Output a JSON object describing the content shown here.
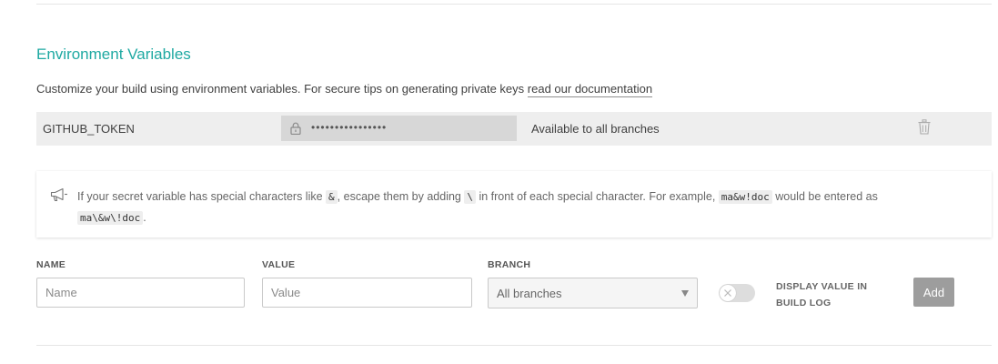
{
  "section": {
    "title": "Environment Variables",
    "intro_text": "Customize your build using environment variables. For secure tips on generating private keys ",
    "intro_link": "read our documentation"
  },
  "variables": [
    {
      "name": "GITHUB_TOKEN",
      "masked_value": "••••••••••••••••",
      "branch": "Available to all branches"
    }
  ],
  "notice": {
    "part1": "If your secret variable has special characters like ",
    "code1": "&",
    "part2": ", escape them by adding ",
    "code2": "\\",
    "part3": " in front of each special character. For example, ",
    "code3": "ma&w!doc",
    "part4": " would be entered as",
    "code4": "ma\\&w\\!doc",
    "part5": "."
  },
  "form": {
    "name_label": "NAME",
    "name_placeholder": "Name",
    "value_label": "VALUE",
    "value_placeholder": "Value",
    "branch_label": "BRANCH",
    "branch_selected": "All branches",
    "display_label": "DISPLAY VALUE IN BUILD LOG",
    "display_enabled": false,
    "add_label": "Add"
  },
  "colors": {
    "accent": "#1fa9a2",
    "row_bg": "#eeeeee",
    "button_bg": "#9d9d9d"
  },
  "icons": [
    "lock-icon",
    "trash-icon",
    "megaphone-icon",
    "chevron-down-icon",
    "close-icon"
  ]
}
